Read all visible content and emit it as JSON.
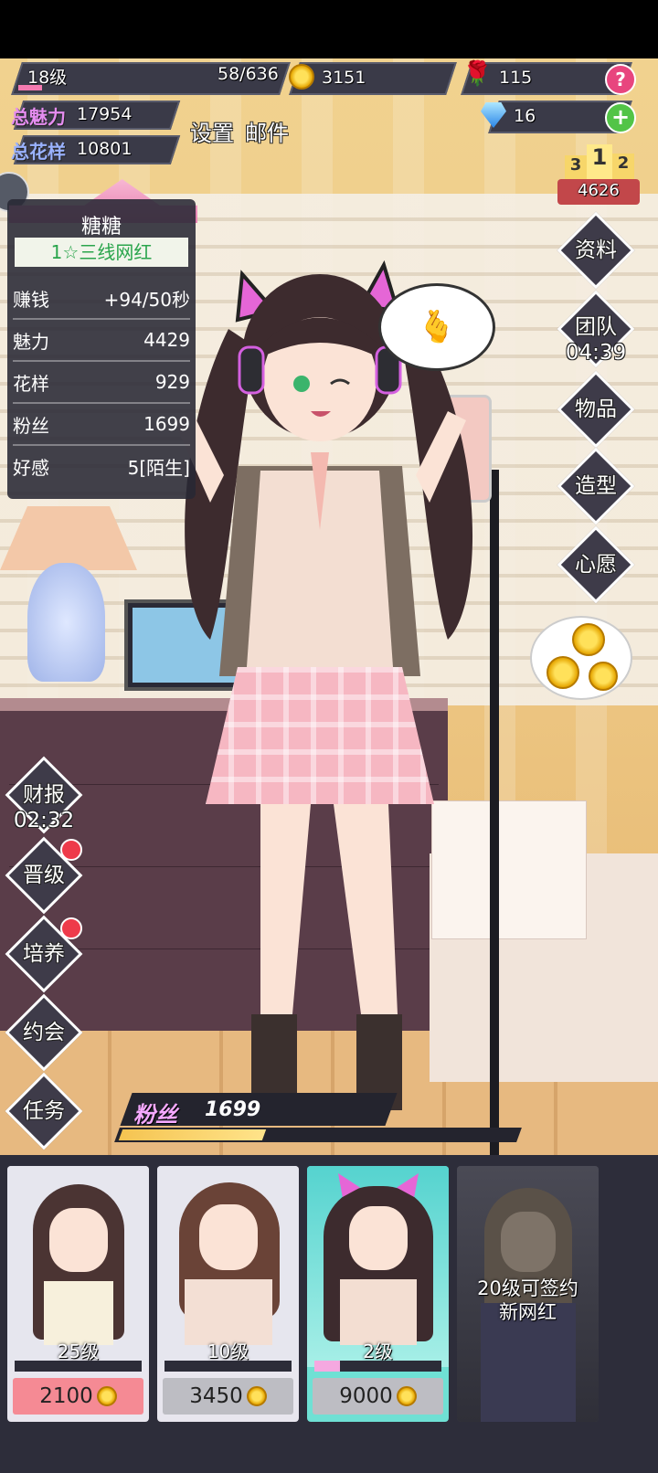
{
  "colors": {
    "accent_pink": "#f06fa0",
    "hud_bg": "#3a3a48",
    "gold": "#ffd54a",
    "red_dot": "#ee3a4a",
    "fans_bar": "#f5c451"
  },
  "hud": {
    "level": "18级",
    "exp": "58/636",
    "exp_fraction": 0.09,
    "coins": "3151",
    "roses": "115",
    "diamonds": "16",
    "charm_label": "总魅力",
    "charm_value": "17954",
    "style_label": "总花样",
    "style_value": "10801",
    "settings": "设置",
    "mail": "邮件",
    "rank_podium": [
      "3",
      "1",
      "2"
    ],
    "rank_value": "4626",
    "help_icon": "question-icon",
    "add_icon": "plus-icon"
  },
  "panel": {
    "name": "糖糖",
    "title": "1☆三线网红",
    "rows": [
      {
        "label": "赚钱",
        "value": "+94/50秒"
      },
      {
        "label": "魅力",
        "value": "4429"
      },
      {
        "label": "花样",
        "value": "929"
      },
      {
        "label": "粉丝",
        "value": "1699"
      },
      {
        "label": "好感",
        "value": "5[陌生]"
      }
    ]
  },
  "right_menu": {
    "profile": "资料",
    "team": "团队",
    "team_timer": "04:39",
    "items": "物品",
    "styling": "造型",
    "wish": "心愿"
  },
  "left_menu": {
    "report": "财报",
    "report_timer": "02:32",
    "promote": "晋级",
    "train": "培养",
    "date": "约会",
    "tasks": "任务"
  },
  "fans_bar": {
    "label": "粉丝",
    "value": "1699",
    "fraction": 0.36
  },
  "cards": [
    {
      "level": "25级",
      "price": "2100",
      "progress": 0.0,
      "price_bg": "#f58a94",
      "card_bg": "#e6e6ee"
    },
    {
      "level": "10级",
      "price": "3450",
      "progress": 0.0,
      "price_bg": "#bdbdc3",
      "card_bg": "#e6e6ee"
    },
    {
      "level": "2级",
      "price": "9000",
      "progress": 0.2,
      "price_bg": "#bdbdc3",
      "card_bg": "#6fe0d4"
    },
    {
      "locked_text_1": "20级可签约",
      "locked_text_2": "新网红"
    }
  ]
}
